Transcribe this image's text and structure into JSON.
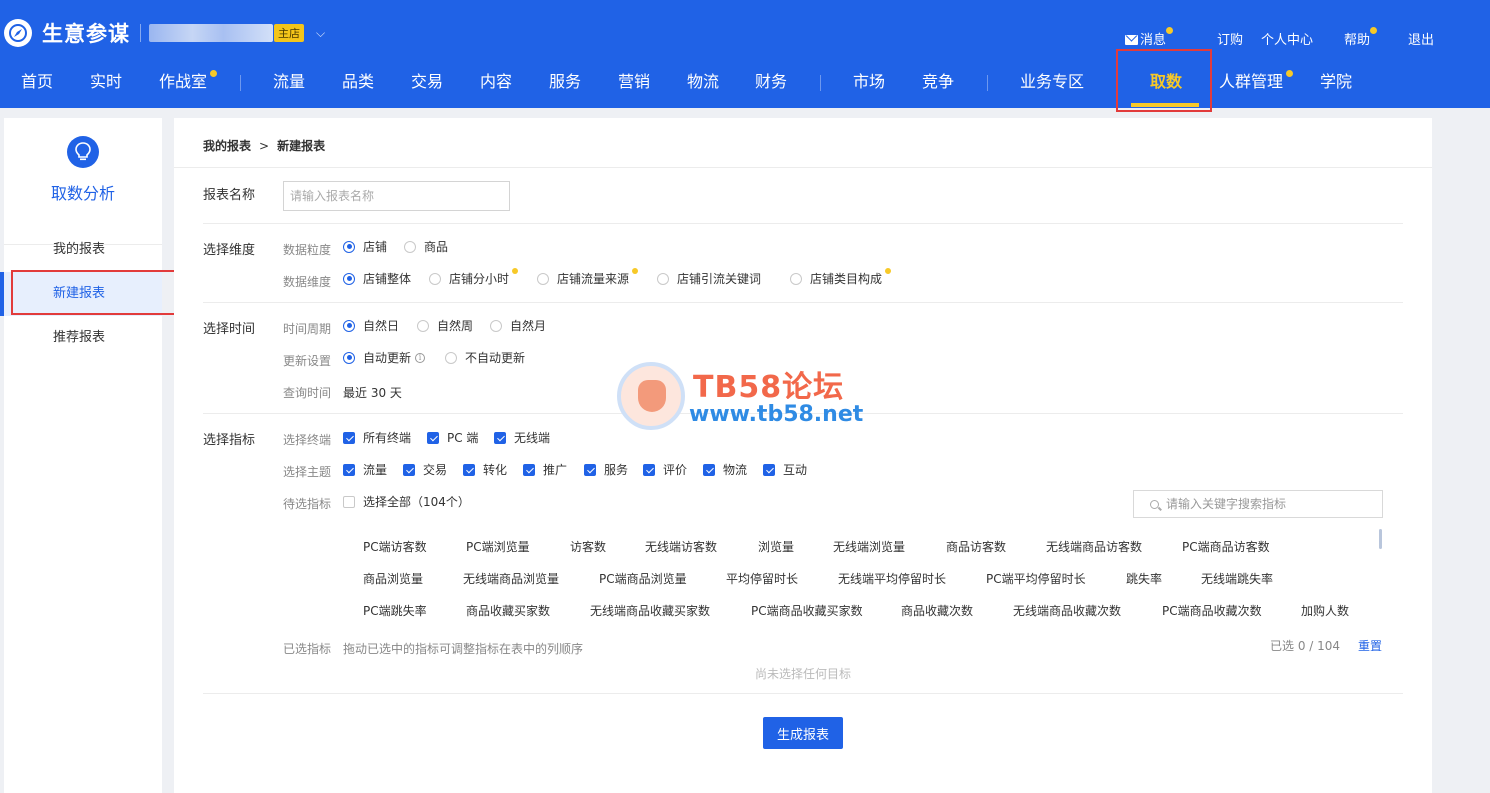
{
  "header": {
    "brand": "生意参谋",
    "shop_tag": "主店",
    "top_links": {
      "messages": "消息",
      "subscribe": "订购",
      "personal_center": "个人中心",
      "help": "帮助",
      "logout": "退出"
    },
    "nav": [
      {
        "label": "首页"
      },
      {
        "label": "实时"
      },
      {
        "label": "作战室"
      },
      {
        "label": "流量"
      },
      {
        "label": "品类"
      },
      {
        "label": "交易"
      },
      {
        "label": "内容"
      },
      {
        "label": "服务"
      },
      {
        "label": "营销"
      },
      {
        "label": "物流"
      },
      {
        "label": "财务"
      },
      {
        "label": "市场"
      },
      {
        "label": "竞争"
      },
      {
        "label": "业务专区"
      },
      {
        "label": "取数"
      },
      {
        "label": "人群管理"
      },
      {
        "label": "学院"
      }
    ],
    "active_nav": "取数",
    "colors": {
      "bar": "#2062e6",
      "accent": "#f7c928",
      "highlight": "#e23b3b"
    }
  },
  "sidebar": {
    "title": "取数分析",
    "icon": "lightbulb-icon",
    "items": [
      {
        "label": "我的报表"
      },
      {
        "label": "新建报表"
      },
      {
        "label": "推荐报表"
      }
    ],
    "active": "新建报表"
  },
  "main": {
    "breadcrumb": {
      "parent": "我的报表",
      "separator": ">",
      "current": "新建报表"
    },
    "report_name": {
      "label": "报表名称",
      "placeholder": "请输入报表名称",
      "value": ""
    },
    "dimension": {
      "label": "选择维度",
      "granularity": {
        "label": "数据粒度",
        "options": [
          "店铺",
          "商品"
        ],
        "selected": "店铺"
      },
      "dimension": {
        "label": "数据维度",
        "options": [
          "店铺整体",
          "店铺分小时",
          "店铺流量来源",
          "店铺引流关键词",
          "店铺类目构成"
        ],
        "selected": "店铺整体"
      }
    },
    "time": {
      "label": "选择时间",
      "period": {
        "label": "时间周期",
        "options": [
          "自然日",
          "自然周",
          "自然月"
        ],
        "selected": "自然日"
      },
      "update": {
        "label": "更新设置",
        "options": [
          "自动更新",
          "不自动更新"
        ],
        "selected": "自动更新"
      },
      "query": {
        "label": "查询时间",
        "value": "最近 30 天"
      }
    },
    "metrics": {
      "label": "选择指标",
      "terminal": {
        "label": "选择终端",
        "options": [
          "所有终端",
          "PC 端",
          "无线端"
        ]
      },
      "theme": {
        "label": "选择主题",
        "options": [
          "流量",
          "交易",
          "转化",
          "推广",
          "服务",
          "评价",
          "物流",
          "互动"
        ]
      },
      "candidates": {
        "label": "待选指标",
        "select_all": "选择全部（104个）"
      },
      "search_placeholder": "请输入关键字搜索指标",
      "items": [
        [
          "PC端访客数",
          "PC端浏览量",
          "访客数",
          "无线端访客数",
          "浏览量",
          "无线端浏览量",
          "商品访客数",
          "无线端商品访客数",
          "PC端商品访客数"
        ],
        [
          "商品浏览量",
          "无线端商品浏览量",
          "PC端商品浏览量",
          "平均停留时长",
          "无线端平均停留时长",
          "PC端平均停留时长",
          "跳失率",
          "无线端跳失率"
        ],
        [
          "PC端跳失率",
          "商品收藏买家数",
          "无线端商品收藏买家数",
          "PC端商品收藏买家数",
          "商品收藏次数",
          "无线端商品收藏次数",
          "PC端商品收藏次数",
          "加购人数"
        ]
      ],
      "selected": {
        "label": "已选指标",
        "hint": "拖动已选中的指标可调整指标在表中的列顺序",
        "count": "已选 0 / 104",
        "reset": "重置",
        "empty": "尚未选择任何目标"
      }
    },
    "generate_button": "生成报表"
  },
  "watermark": {
    "title": "TB58论坛",
    "url": "www.tb58.net"
  }
}
